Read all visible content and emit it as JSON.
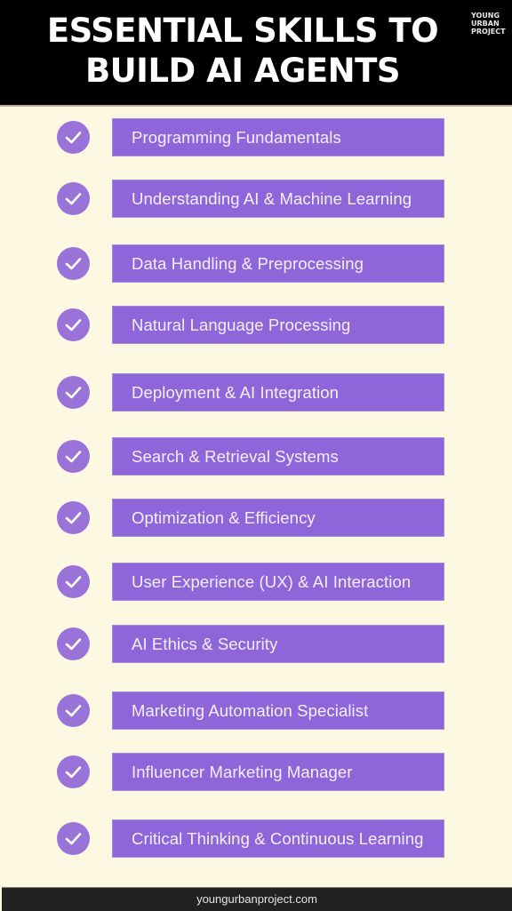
{
  "header": {
    "title_lines": [
      "ESSENTIAL SKILLS TO",
      "BUILD AI AGENTS"
    ],
    "brand_lines": [
      "YOUNG",
      "URBAN",
      "PROJECT"
    ]
  },
  "colors": {
    "header_bg": "#000000",
    "page_bg": "#fdf8e1",
    "bar_bg": "#8f66d9",
    "check_bg": "#9a73d9",
    "footer_bg": "#212121"
  },
  "skills": [
    {
      "label": "Programming Fundamentals",
      "icon": "check-circle-icon"
    },
    {
      "label": "Understanding AI & Machine Learning",
      "icon": "check-circle-icon"
    },
    {
      "label": "Data Handling & Preprocessing",
      "icon": "check-circle-icon"
    },
    {
      "label": "Natural Language Processing",
      "icon": "check-circle-icon"
    },
    {
      "label": "Deployment & AI Integration",
      "icon": "check-circle-icon"
    },
    {
      "label": "Search & Retrieval Systems",
      "icon": "check-circle-icon"
    },
    {
      "label": "Optimization & Efficiency",
      "icon": "check-circle-icon"
    },
    {
      "label": "User Experience (UX) & AI Interaction",
      "icon": "check-circle-icon"
    },
    {
      "label": "AI Ethics & Security",
      "icon": "check-circle-icon"
    },
    {
      "label": "Marketing Automation Specialist",
      "icon": "check-circle-icon"
    },
    {
      "label": "Influencer Marketing Manager",
      "icon": "check-circle-icon"
    },
    {
      "label": "Critical Thinking & Continuous Learning",
      "icon": "check-circle-icon"
    }
  ],
  "footer": {
    "url": "youngurbanproject.com"
  }
}
